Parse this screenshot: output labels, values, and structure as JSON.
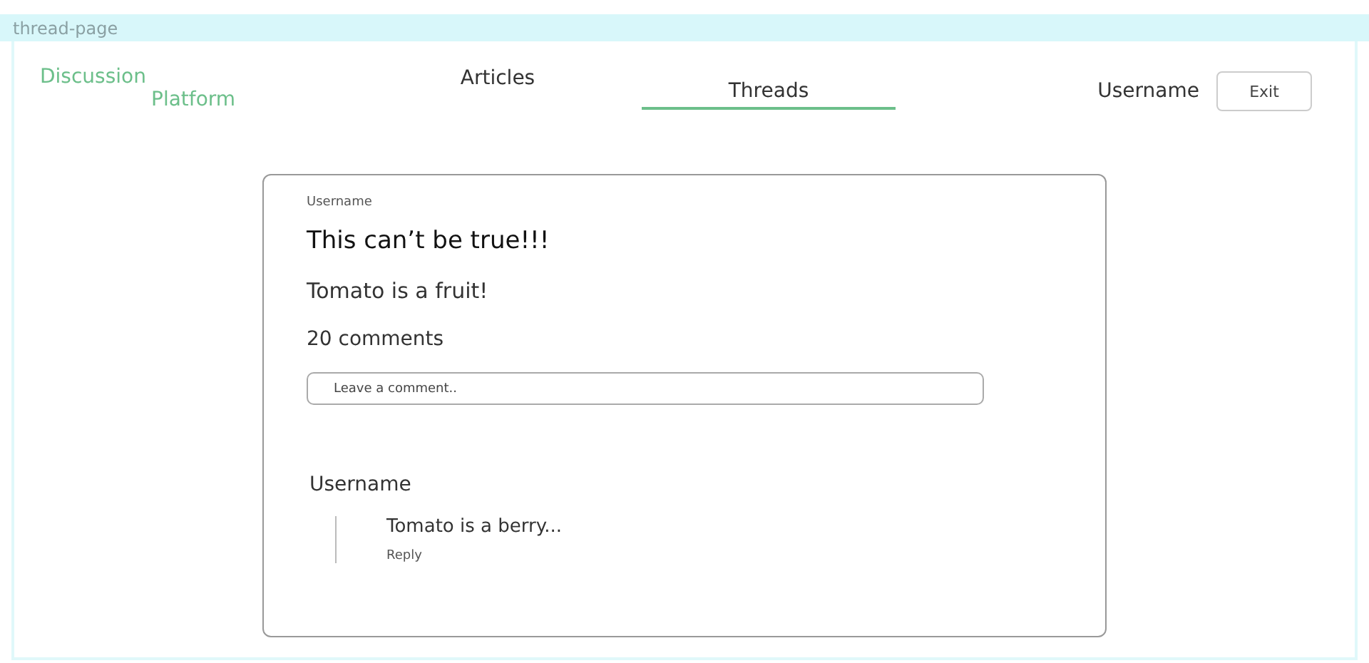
{
  "frame": {
    "label": "thread-page"
  },
  "logo": {
    "line_1": "Discussion",
    "line_2": "Platform"
  },
  "tabs": [
    {
      "label": "Articles",
      "selected": false
    },
    {
      "label": "Threads",
      "selected": true
    }
  ],
  "user": {
    "name": "Username",
    "button": "Exit"
  },
  "thread": {
    "author": "Username",
    "title": "This can’t be true!!!",
    "body": "Tomato is a fruit!",
    "comment_count": "20 comments",
    "comment_field": {
      "placeholder": "Leave a comment.."
    },
    "comments": [
      {
        "author": "Username",
        "text": "Tomato is a berry...",
        "action": "Reply"
      }
    ]
  }
}
